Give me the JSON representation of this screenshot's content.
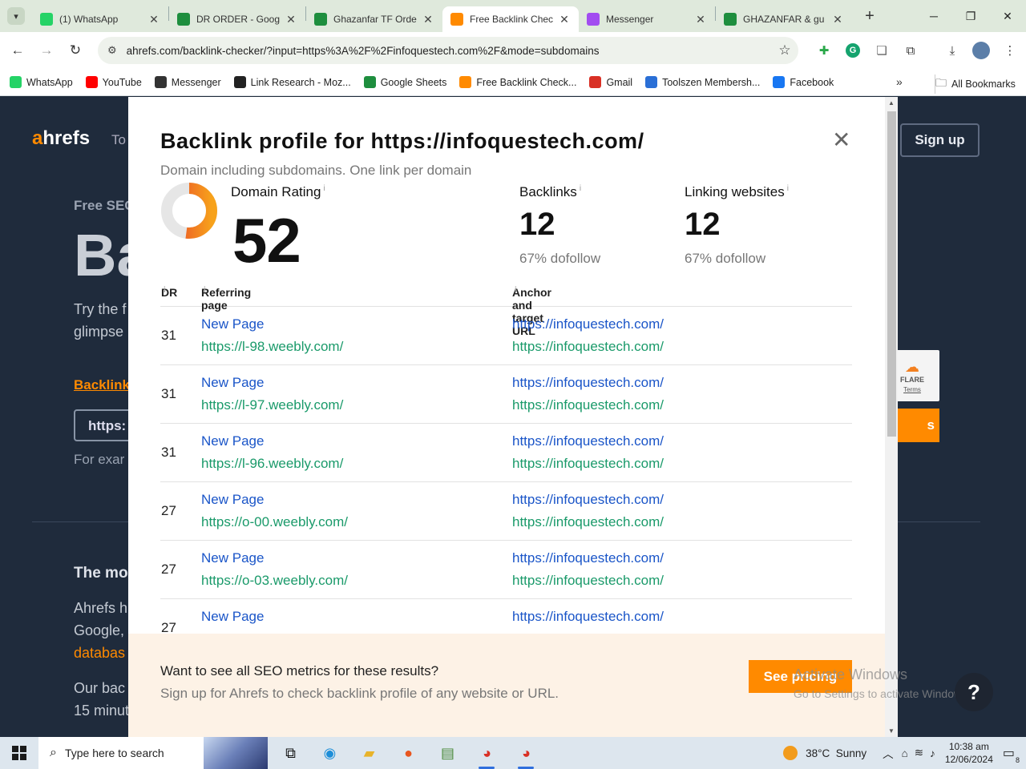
{
  "browser": {
    "tabs": [
      {
        "title": "(1) WhatsApp",
        "icon": "whatsapp-icon",
        "color": "#25d366",
        "active": false
      },
      {
        "title": "DR ORDER - Goog",
        "icon": "sheets-icon",
        "color": "#1e8e3e",
        "active": false
      },
      {
        "title": "Ghazanfar TF Orde",
        "icon": "sheets-icon",
        "color": "#1e8e3e",
        "active": false
      },
      {
        "title": "Free Backlink Chec",
        "icon": "ahrefs-icon",
        "color": "#ff8a00",
        "active": true
      },
      {
        "title": "Messenger",
        "icon": "messenger-icon",
        "color": "#a24cf0",
        "active": false
      },
      {
        "title": "GHAZANFAR & gu",
        "icon": "sheets-icon",
        "color": "#1e8e3e",
        "active": false
      }
    ],
    "url": "ahrefs.com/backlink-checker/?input=https%3A%2F%2Finfoquestech.com%2F&mode=subdomains",
    "bookmarks": [
      {
        "label": "WhatsApp",
        "icon": "whatsapp-icon",
        "color": "#25d366"
      },
      {
        "label": "YouTube",
        "icon": "youtube-icon",
        "color": "#ff0000"
      },
      {
        "label": "Messenger",
        "icon": "messenger-icon",
        "color": "#333333"
      },
      {
        "label": "Link Research - Moz...",
        "icon": "moz-icon",
        "color": "#222222"
      },
      {
        "label": "Google Sheets",
        "icon": "sheets-icon",
        "color": "#1e8e3e"
      },
      {
        "label": "Free Backlink Check...",
        "icon": "ahrefs-icon",
        "color": "#ff8a00"
      },
      {
        "label": "Gmail",
        "icon": "gmail-icon",
        "color": "#d93025"
      },
      {
        "label": "Toolszen Membersh...",
        "icon": "toolszen-icon",
        "color": "#2a6fd6"
      },
      {
        "label": "Facebook",
        "icon": "facebook-icon",
        "color": "#1877f2"
      }
    ],
    "all_bookmarks": "All Bookmarks"
  },
  "background_page": {
    "logo_a": "a",
    "logo_rest": "hrefs",
    "tools": "To",
    "signup": "Sign up",
    "free_seo": "Free SEO",
    "big_title": "Ba",
    "try_line1": "Try the f",
    "try_line2": "glimpse",
    "backlink_link": "Backlink",
    "input_value": "https:",
    "for_example": "For exar",
    "the_most": "The mo",
    "ahrefs_h": "Ahrefs h",
    "google": "Google,",
    "database": "databas",
    "our_bac": "Our bac",
    "fifteen": "15 minut",
    "cf_label": "FLARE",
    "cf_terms": "Terms",
    "cf_btn": "s"
  },
  "modal": {
    "title": "Backlink profile for https://infoquestech.com/",
    "subtitle": "Domain including subdomains. One link per domain",
    "domain_rating_label": "Domain Rating",
    "domain_rating_value": "52",
    "domain_rating_fraction": 0.52,
    "backlinks_label": "Backlinks",
    "backlinks_value": "12",
    "backlinks_dofollow": "67% dofollow",
    "linking_label": "Linking websites",
    "linking_value": "12",
    "linking_dofollow": "67% dofollow",
    "columns": {
      "dr": "DR",
      "referring": "Referring page",
      "anchor": "Anchor and target URL"
    },
    "rows": [
      {
        "dr": "31",
        "title": "New Page",
        "url": "https://l-98.weebly.com/",
        "anchor": "https://infoquestech.com/",
        "target": "https://infoquestech.com/"
      },
      {
        "dr": "31",
        "title": "New Page",
        "url": "https://l-97.weebly.com/",
        "anchor": "https://infoquestech.com/",
        "target": "https://infoquestech.com/"
      },
      {
        "dr": "31",
        "title": "New Page",
        "url": "https://l-96.weebly.com/",
        "anchor": "https://infoquestech.com/",
        "target": "https://infoquestech.com/"
      },
      {
        "dr": "27",
        "title": "New Page",
        "url": "https://o-00.weebly.com/",
        "anchor": "https://infoquestech.com/",
        "target": "https://infoquestech.com/"
      },
      {
        "dr": "27",
        "title": "New Page",
        "url": "https://o-03.weebly.com/",
        "anchor": "https://infoquestech.com/",
        "target": "https://infoquestech.com/"
      },
      {
        "dr": "27",
        "title": "New Page",
        "url": "",
        "anchor": "https://infoquestech.com/",
        "target": ""
      }
    ],
    "promo_title": "Want to see all SEO metrics for these results?",
    "promo_sub": "Sign up for Ahrefs to check backlink profile of any website or URL.",
    "promo_button": "See pricing"
  },
  "overlay": {
    "watermark_title": "Activate Windows",
    "watermark_sub": "Go to Settings to activate Windows.",
    "help": "?"
  },
  "taskbar": {
    "search_placeholder": "Type here to search",
    "weather": "38°C  Sunny",
    "time": "10:38 am",
    "date": "12/06/2024",
    "notifications": "8"
  },
  "colors": {
    "accent": "#ff8a00",
    "link_blue": "#1a55c8",
    "link_green": "#1a9a6a"
  }
}
